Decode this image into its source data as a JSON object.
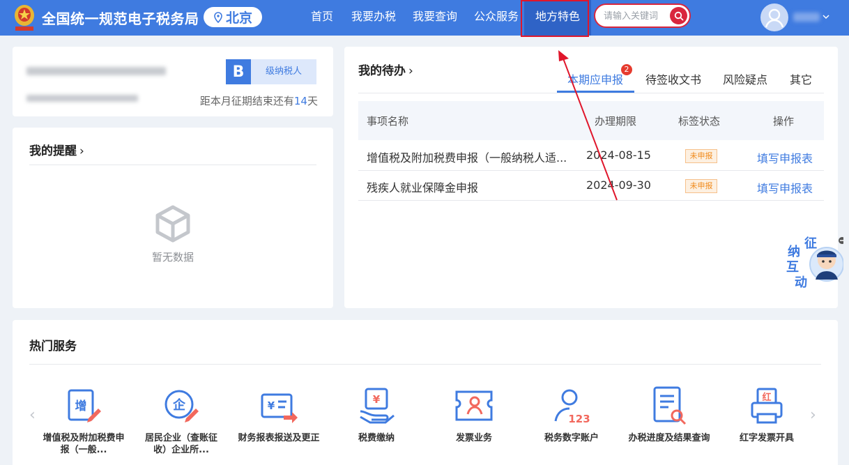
{
  "header": {
    "site_title": "全国统一规范电子税务局",
    "city": "北京",
    "nav": [
      "首页",
      "我要办税",
      "我要查询",
      "公众服务",
      "地方特色"
    ],
    "active_nav": "地方特色",
    "search_placeholder": "请输入关键词"
  },
  "taxpayer": {
    "grade_letter": "B",
    "grade_label": "级纳税人",
    "deadline_prefix": "距本月征期结束还有",
    "deadline_days": "14",
    "deadline_suffix": "天"
  },
  "reminders": {
    "title": "我的提醒",
    "empty_text": "暂无数据"
  },
  "todo": {
    "title": "我的待办",
    "tabs": [
      "本期应申报",
      "待签收文书",
      "风险疑点",
      "其它"
    ],
    "active_tab_badge": "2",
    "columns": [
      "事项名称",
      "办理期限",
      "标签状态",
      "操作"
    ],
    "rows": [
      {
        "name": "增值税及附加税费申报（一般纳税人适...",
        "deadline": "2024-08-15",
        "status": "未申报",
        "action": "填写申报表"
      },
      {
        "name": "残疾人就业保障金申报",
        "deadline": "2024-09-30",
        "status": "未申报",
        "action": "填写申报表"
      }
    ]
  },
  "hot_services": {
    "title": "热门服务",
    "items": [
      {
        "label": "增值税及附加税费申报（一般...",
        "icon": "vat-declare-icon"
      },
      {
        "label": "居民企业（查账征收）企业所...",
        "icon": "enterprise-tax-icon"
      },
      {
        "label": "财务报表报送及更正",
        "icon": "financial-report-icon"
      },
      {
        "label": "税费缴纳",
        "icon": "tax-payment-icon"
      },
      {
        "label": "发票业务",
        "icon": "invoice-icon"
      },
      {
        "label": "税务数字账户",
        "icon": "digital-account-icon"
      },
      {
        "label": "办税进度及结果查询",
        "icon": "progress-query-icon"
      },
      {
        "label": "红字发票开具",
        "icon": "red-invoice-icon"
      }
    ]
  },
  "assistant": {
    "chars": [
      "征",
      "纳",
      "互",
      "动"
    ]
  },
  "colors": {
    "brand": "#3f7be0",
    "highlight": "#e0162b",
    "status_warning": "#f08a1c"
  }
}
